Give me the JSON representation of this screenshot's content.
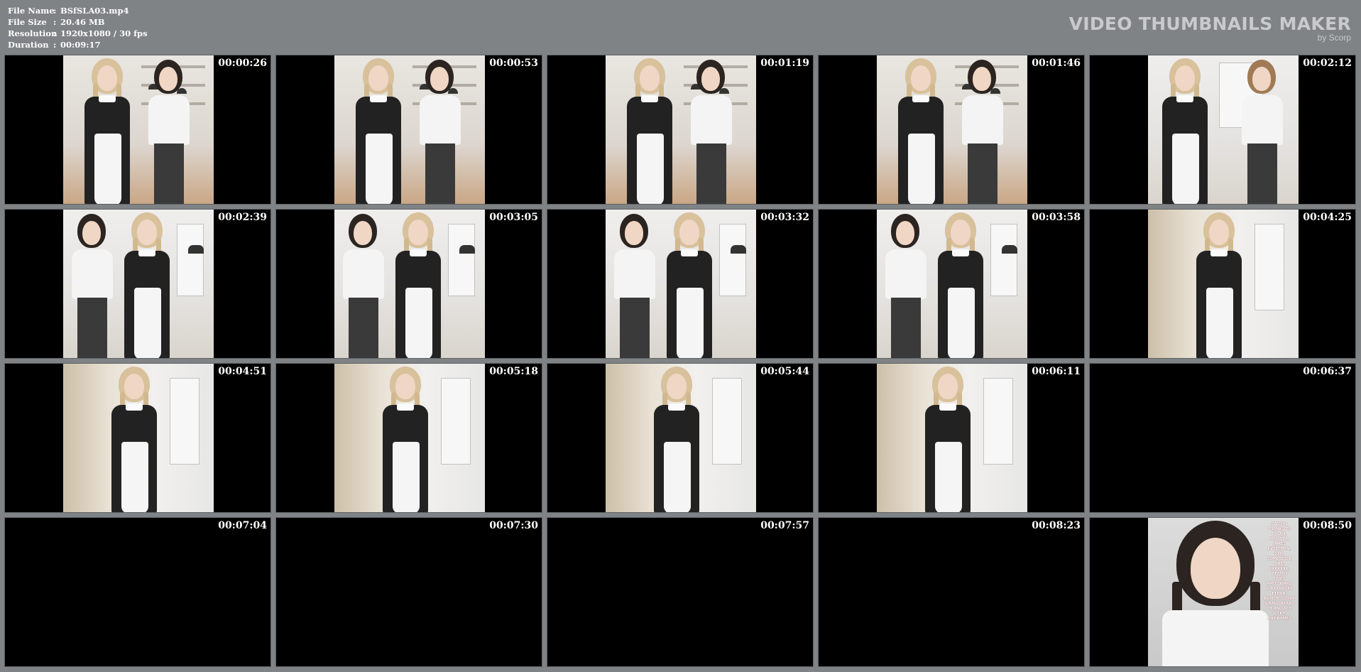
{
  "info": [
    {
      "label": "File Name",
      "sep": ":",
      "value": "BSfSLA03.mp4"
    },
    {
      "label": "File Size",
      "sep": ":",
      "value": "20.46 MB"
    },
    {
      "label": "Resolution",
      "sep": ":",
      "value": "1920x1080 / 30 fps"
    },
    {
      "label": "Duration",
      "sep": ":",
      "value": "00:09:17"
    }
  ],
  "brand": {
    "title": "VIDEO THUMBNAILS MAKER",
    "subtitle": "by Scorp"
  },
  "thumbnails": [
    {
      "time": "00:00:26",
      "scene": "two-kitchen"
    },
    {
      "time": "00:00:53",
      "scene": "two-kitchen"
    },
    {
      "time": "00:01:19",
      "scene": "two-kitchen"
    },
    {
      "time": "00:01:46",
      "scene": "two-kitchen"
    },
    {
      "time": "00:02:12",
      "scene": "two-back"
    },
    {
      "time": "00:02:39",
      "scene": "two-living"
    },
    {
      "time": "00:03:05",
      "scene": "two-living"
    },
    {
      "time": "00:03:32",
      "scene": "two-living"
    },
    {
      "time": "00:03:58",
      "scene": "two-living"
    },
    {
      "time": "00:04:25",
      "scene": "single-panel"
    },
    {
      "time": "00:04:51",
      "scene": "single-panel"
    },
    {
      "time": "00:05:18",
      "scene": "single-panel"
    },
    {
      "time": "00:05:44",
      "scene": "single-panel"
    },
    {
      "time": "00:06:11",
      "scene": "single-panel"
    },
    {
      "time": "00:06:37",
      "scene": "black"
    },
    {
      "time": "00:07:04",
      "scene": "black"
    },
    {
      "time": "00:07:30",
      "scene": "black"
    },
    {
      "time": "00:07:57",
      "scene": "black"
    },
    {
      "time": "00:08:23",
      "scene": "black"
    },
    {
      "time": "00:08:50",
      "scene": "portrait"
    }
  ],
  "credits": [
    "SPECIAL THANKS TO",
    "DYLAN,",
    "PHILIPPA,",
    "JAMES EVERTMAN,",
    "SAN,",
    "SOME DUDE ONE,",
    "XXXXXXX,",
    "TIFFANY",
    "FRIES",
    "AMOS WARD",
    "& BRADBURY",
    "ETHAN,",
    "BEALDE SOORY",
    "& BALD BEARD",
    "TT AND ACE",
    "& SKY,",
    "ANY NAMES"
  ],
  "colors": {
    "background": "#7f8385",
    "thumb_background": "#000000",
    "timestamp": "#ffffff",
    "brand": "#c8cacc"
  }
}
